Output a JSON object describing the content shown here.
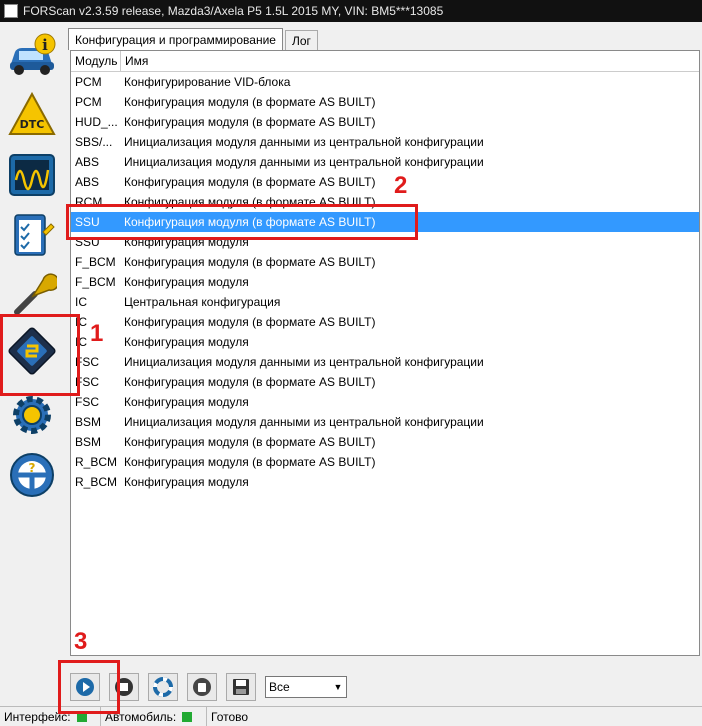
{
  "window": {
    "title": "FORScan v2.3.59 release, Mazda3/Axela P5 1.5L 2015 MY, VIN: BM5***13085"
  },
  "sidebar": {
    "items": [
      {
        "icon": "car-info-icon"
      },
      {
        "icon": "dtc-icon"
      },
      {
        "icon": "oscilloscope-icon"
      },
      {
        "icon": "checklist-icon"
      },
      {
        "icon": "wrench-icon"
      },
      {
        "icon": "chip-config-icon"
      },
      {
        "icon": "gear-icon"
      },
      {
        "icon": "steering-wheel-icon"
      }
    ]
  },
  "tabs": [
    {
      "label": "Конфигурация и программирование",
      "active": true
    },
    {
      "label": "Лог",
      "active": false
    }
  ],
  "list": {
    "columns": [
      "Модуль",
      "Имя"
    ],
    "rows": [
      {
        "module": "PCM",
        "name": "Конфигурирование VID-блока"
      },
      {
        "module": "PCM",
        "name": "Конфигурация модуля (в формате AS BUILT)"
      },
      {
        "module": "HUD_...",
        "name": "Конфигурация модуля (в формате AS BUILT)"
      },
      {
        "module": "SBS/...",
        "name": "Инициализация модуля данными из центральной конфигурации"
      },
      {
        "module": "ABS",
        "name": "Инициализация модуля данными из центральной конфигурации"
      },
      {
        "module": "ABS",
        "name": "Конфигурация модуля (в формате AS BUILT)"
      },
      {
        "module": "RCM",
        "name": "Конфигурация модуля (в формате AS BUILT)"
      },
      {
        "module": "SSU",
        "name": "Конфигурация модуля (в формате AS BUILT)",
        "selected": true
      },
      {
        "module": "SSU",
        "name": "Конфигурация модуля"
      },
      {
        "module": "F_BCM",
        "name": "Конфигурация модуля (в формате AS BUILT)"
      },
      {
        "module": "F_BCM",
        "name": "Конфигурация модуля"
      },
      {
        "module": "IC",
        "name": "Центральная конфигурация"
      },
      {
        "module": "IC",
        "name": "Конфигурация модуля (в формате AS BUILT)"
      },
      {
        "module": "IC",
        "name": "Конфигурация модуля"
      },
      {
        "module": "FSC",
        "name": "Инициализация модуля данными из центральной конфигурации"
      },
      {
        "module": "FSC",
        "name": "Конфигурация модуля (в формате AS BUILT)"
      },
      {
        "module": "FSC",
        "name": "Конфигурация модуля"
      },
      {
        "module": "BSM",
        "name": "Инициализация модуля данными из центральной конфигурации"
      },
      {
        "module": "BSM",
        "name": "Конфигурация модуля (в формате AS BUILT)"
      },
      {
        "module": "R_BCM",
        "name": "Конфигурация модуля (в формате AS BUILT)"
      },
      {
        "module": "R_BCM",
        "name": "Конфигурация модуля"
      }
    ]
  },
  "toolbar": {
    "buttons": [
      "play-icon",
      "stop-icon",
      "lifebuoy-icon",
      "erase-icon",
      "save-icon"
    ],
    "filter_value": "Все"
  },
  "status": {
    "interface_label": "Интерфейс:",
    "vehicle_label": "Автомобиль:",
    "state": "Готово",
    "led_color": "#22aa33"
  },
  "annotations": {
    "n1": "1",
    "n2": "2",
    "n3": "3",
    "color": "#e01b1b"
  }
}
